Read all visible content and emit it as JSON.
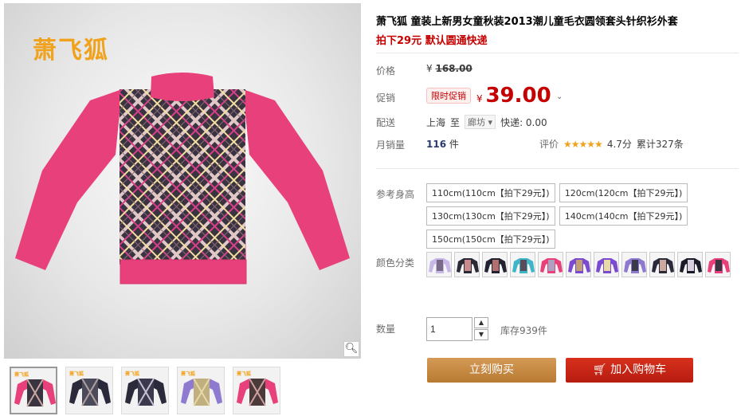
{
  "gallery": {
    "brand": "萧飞狐",
    "zoom_icon": "magnifier-icon",
    "thumbnails": [
      {
        "label": "萧飞狐",
        "colors": [
          "#e8407a",
          "#3a3340",
          "#c9a9a0"
        ]
      },
      {
        "label": "萧飞狐",
        "colors": [
          "#2a2a3a",
          "#4a4a5a",
          "#b0a0a0"
        ]
      },
      {
        "label": "萧飞狐",
        "colors": [
          "#2a2a3a",
          "#3a3a4c",
          "#c8c0d8"
        ]
      },
      {
        "label": "萧飞狐",
        "colors": [
          "#8e7ad1",
          "#c0b080",
          "#e8d8a8"
        ]
      },
      {
        "label": "萧飞狐",
        "colors": [
          "#e8407a",
          "#4a3a3a",
          "#d0a0a0"
        ]
      }
    ]
  },
  "product": {
    "title": "萧飞狐 童装上新男女童秋装2013潮儿童毛衣圆领套头针织衫外套",
    "subtitle": "拍下29元 默认圆通快递",
    "price_label": "价格",
    "original_price": "¥",
    "original_price_value": "168.00",
    "promo_label": "促销",
    "promo_badge": "限时促销",
    "currency": "¥",
    "current_price": "39.00",
    "ship_label": "配送",
    "ship_from": "上海",
    "ship_to_word": "至",
    "ship_city": "廊坊",
    "ship_fee": "快递: 0.00",
    "monthly_label": "月销量",
    "monthly_count": "116",
    "monthly_unit": "件",
    "rating_label": "评价",
    "rating_score": "4.7分",
    "rating_count": "累计327条",
    "size_label": "参考身高",
    "sizes": [
      "110cm(110cm【拍下29元】)",
      "120cm(120cm【拍下29元】)",
      "130cm(130cm【拍下29元】)",
      "140cm(140cm【拍下29元】)",
      "150cm(150cm【拍下29元】)"
    ],
    "color_label": "颜色分类",
    "color_swatches": [
      {
        "body": "#c8b8e8",
        "sleeve": "#c8b8e8",
        "chest": "#7a6a8a"
      },
      {
        "body": "#2a2a36",
        "sleeve": "#2a2a36",
        "chest": "#c88a8a"
      },
      {
        "body": "#222230",
        "sleeve": "#222230",
        "chest": "#b07070"
      },
      {
        "body": "#3fb6c8",
        "sleeve": "#3fb6c8",
        "chest": "#5a4a5a"
      },
      {
        "body": "#e8407a",
        "sleeve": "#e8407a",
        "chest": "#b0a0c0"
      },
      {
        "body": "#7a4ad0",
        "sleeve": "#7a4ad0",
        "chest": "#c0a070"
      },
      {
        "body": "#7a4ad0",
        "sleeve": "#7a4ad0",
        "chest": "#e8d8a8"
      },
      {
        "body": "#8e7ad1",
        "sleeve": "#8e7ad1",
        "chest": "#3a3a4a"
      },
      {
        "body": "#2a2a3a",
        "sleeve": "#2a2a3a",
        "chest": "#c9a9a0"
      },
      {
        "body": "#1a1a28",
        "sleeve": "#1a1a28",
        "chest": "#d8d0e0"
      },
      {
        "body": "#e8407a",
        "sleeve": "#e8407a",
        "chest": "#3a3340"
      }
    ],
    "qty_label": "数量",
    "qty_value": "1",
    "stock": "库存939件",
    "buy_now": "立刻购买",
    "add_to_cart": "加入购物车"
  }
}
